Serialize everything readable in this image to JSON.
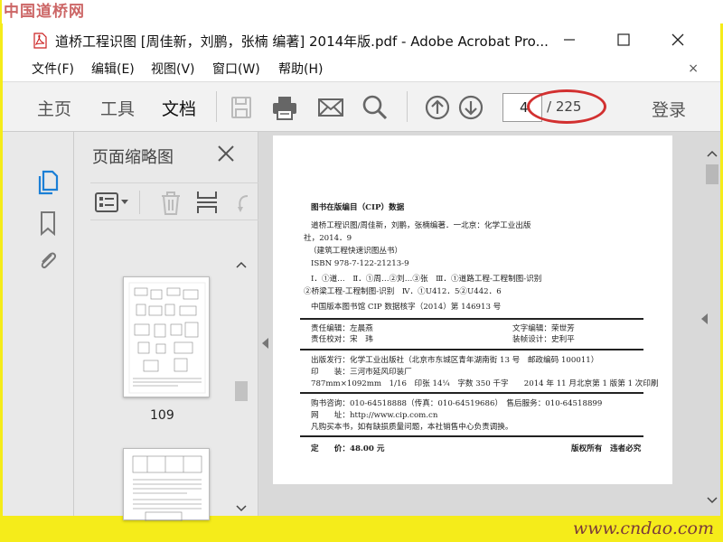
{
  "watermark_top": "中国道桥网",
  "watermark_bottom": "www.cndao.com",
  "window": {
    "title": "道桥工程识图 [周佳新，刘鹏，张楠 编著] 2014年版.pdf - Adobe Acrobat Pro..."
  },
  "menu": {
    "items": [
      "文件(F)",
      "编辑(E)",
      "视图(V)",
      "窗口(W)",
      "帮助(H)"
    ],
    "close": "×"
  },
  "toolbar": {
    "tabs": [
      "主页",
      "工具",
      "文档"
    ],
    "active_tab": "文档",
    "page_current": "4",
    "page_total": "/ 225",
    "login": "登录",
    "icons": [
      "save-icon",
      "print-icon",
      "email-icon",
      "search-icon",
      "prev-page-icon",
      "next-page-icon"
    ]
  },
  "thumbnails": {
    "title": "页面缩略图",
    "page_label": "109"
  },
  "colors": {
    "highlight_ellipse": "#d23030",
    "rail_active": "#1b7fd6",
    "frame": "#f5ec1a"
  },
  "doc": {
    "lines": [
      "图书在版编目（CIP）数据",
      "道桥工程识图/周佳新，刘鹏，张楠编著．一北京：化学工业出版",
      "社，2014．9",
      "（建筑工程快速识图丛书）",
      "ISBN 978-7-122-21213-9",
      "Ⅰ．①道…　Ⅱ．①周…②刘…③张　Ⅲ．①道路工程-工程制图-识别",
      "②桥梁工程-工程制图-识别　Ⅳ．①U412．5②U442．6",
      "中国版本图书馆 CIP 数据核字（2014）第 146913 号",
      "责任编辑：左晨燕",
      "文字编辑：荣世芳",
      "责任校对：宋　玮",
      "装帧设计：史利平",
      "出版发行：化学工业出版社（北京市东城区青年湖南街 13 号　邮政编码 100011）",
      "印　　装：三河市延风印装厂",
      "787mm×1092mm　1/16　印张 14¼　字数 350 千字　　2014 年 11 月北京第 1 版第 1 次印刷",
      "购书咨询：010-64518888（传真：010-64519686）　售后服务：010-64518899",
      "网　　址：http://www.cip.com.cn",
      "凡购买本书，如有缺损质量问题，本社销售中心负责调换。",
      "定　　价：48.00 元",
      "版权所有　违者必究"
    ]
  }
}
